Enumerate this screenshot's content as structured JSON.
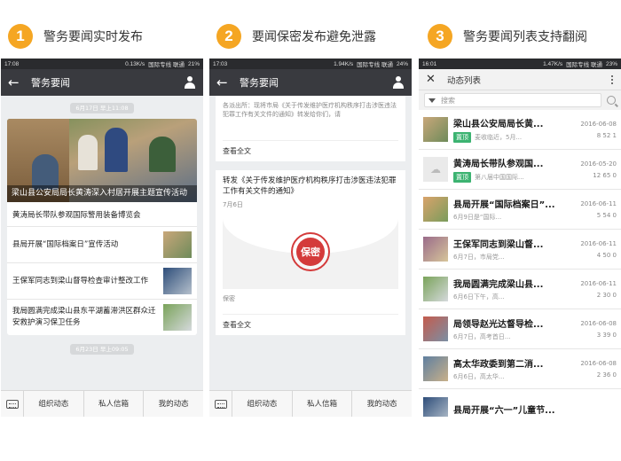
{
  "captions": [
    {
      "num": "1",
      "text": "警务要闻实时发布"
    },
    {
      "num": "2",
      "text": "要闻保密发布避免泄露"
    },
    {
      "num": "3",
      "text": "警务要闻列表支持翻阅"
    }
  ],
  "phone1": {
    "status": {
      "time": "17:08",
      "speed": "0.13K/s",
      "carrier": "国际专线 联通",
      "battery": "21%"
    },
    "appbar": {
      "back": "←",
      "title": "警务要闻"
    },
    "date1": "6月17日 早上11:08",
    "cover_caption": "梁山县公安局局长黄涛深入村居开展主题宣传活动",
    "headline2": "黄涛局长带队参观国际警用装备博览会",
    "items": [
      {
        "title": "县局开展“国际档案日”宣传活动"
      },
      {
        "title": "王保军同志到梁山督导检查审计整改工作"
      },
      {
        "title": "我局圆满完成梁山县东平湖蓄滞洪区群众迁安救护演习保卫任务"
      }
    ],
    "date2": "6月23日 早上09:05",
    "menu": [
      "组织动态",
      "私人信箱",
      "我的动态"
    ]
  },
  "phone2": {
    "status": {
      "time": "17:03",
      "speed": "1.94K/s",
      "carrier": "国际专线 联通",
      "battery": "24%"
    },
    "appbar": {
      "back": "←",
      "title": "警务要闻"
    },
    "card1_text": "各派出所：现将市局《关于传发维护医疗机构秩序打击涉医违法犯罪工作有关文件的通知》转发给你们，请",
    "card1_readall": "查看全文",
    "card2_title": "转发《关于传发维护医疗机构秩序打击涉医违法犯罪工作有关文件的通知》",
    "card2_date": "7月6日",
    "seal_text": "保密",
    "card2_status": "保密",
    "card2_readall": "查看全文",
    "menu": [
      "组织动态",
      "私人信箱",
      "我的动态"
    ]
  },
  "phone3": {
    "status": {
      "time": "16:01",
      "speed": "1.47K/s",
      "carrier": "国际专线 联通",
      "battery": "23%"
    },
    "appbar": {
      "close": "✕",
      "title": "动态列表"
    },
    "search_placeholder": "搜索",
    "items": [
      {
        "title": "梁山县公安局局长黄...",
        "pin": "置顶",
        "sub": "麦收临近，5月...",
        "date": "2016-06-08",
        "stats": "8 52 1"
      },
      {
        "title": "黄涛局长带队参观国...",
        "pin": "置顶",
        "sub": "第八届中国国际...",
        "date": "2016-05-20",
        "stats": "12 65 0"
      },
      {
        "title": "县局开展“国际档案日”...",
        "pin": "",
        "sub": "6月9日是“国际...",
        "date": "2016-06-11",
        "stats": "5 54 0"
      },
      {
        "title": "王保军同志到梁山督...",
        "pin": "",
        "sub": "6月7日，市局党...",
        "date": "2016-06-11",
        "stats": "4 50 0"
      },
      {
        "title": "我局圆满完成梁山县...",
        "pin": "",
        "sub": "6月6日下午，高...",
        "date": "2016-06-11",
        "stats": "2 30 0"
      },
      {
        "title": "局领导赵光达督导检...",
        "pin": "",
        "sub": "6月7日，高考首日...",
        "date": "2016-06-08",
        "stats": "3 39 0"
      },
      {
        "title": "高太华政委到第二消...",
        "pin": "",
        "sub": "6月6日，高太华...",
        "date": "2016-06-08",
        "stats": "2 36 0"
      },
      {
        "title": "县局开展“六一”儿童节...",
        "pin": "",
        "sub": "",
        "date": "",
        "stats": ""
      }
    ]
  }
}
